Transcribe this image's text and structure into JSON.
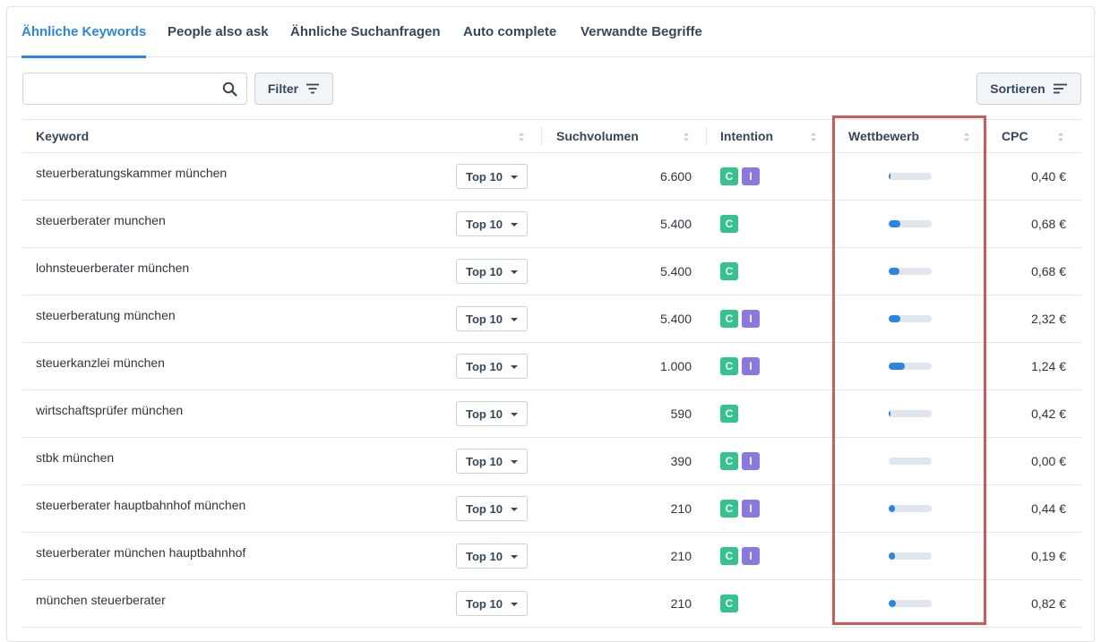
{
  "tabs": [
    {
      "label": "Ähnliche Keywords",
      "active": true
    },
    {
      "label": "People also ask",
      "active": false
    },
    {
      "label": "Ähnliche Suchanfragen",
      "active": false
    },
    {
      "label": "Auto complete",
      "active": false
    },
    {
      "label": "Verwandte Begriffe",
      "active": false
    }
  ],
  "toolbar": {
    "search_value": "",
    "search_placeholder": "",
    "filter_label": "Filter",
    "sort_label": "Sortieren"
  },
  "table": {
    "columns": {
      "keyword": "Keyword",
      "volume": "Suchvolumen",
      "intent": "Intention",
      "competition": "Wettbewerb",
      "cpc": "CPC"
    },
    "rows": [
      {
        "keyword": "steuerberatungskammer münchen",
        "serp": "Top 10",
        "volume": "6.600",
        "intents": [
          "C",
          "I"
        ],
        "competition": 0.02,
        "cpc": "0,40 €"
      },
      {
        "keyword": "steuerberater munchen",
        "serp": "Top 10",
        "volume": "5.400",
        "intents": [
          "C"
        ],
        "competition": 0.27,
        "cpc": "0,68 €"
      },
      {
        "keyword": "lohnsteuerberater münchen",
        "serp": "Top 10",
        "volume": "5.400",
        "intents": [
          "C"
        ],
        "competition": 0.25,
        "cpc": "0,68 €"
      },
      {
        "keyword": "steuerberatung münchen",
        "serp": "Top 10",
        "volume": "5.400",
        "intents": [
          "C",
          "I"
        ],
        "competition": 0.27,
        "cpc": "2,32 €"
      },
      {
        "keyword": "steuerkanzlei münchen",
        "serp": "Top 10",
        "volume": "1.000",
        "intents": [
          "C",
          "I"
        ],
        "competition": 0.38,
        "cpc": "1,24 €"
      },
      {
        "keyword": "wirtschaftsprüfer münchen",
        "serp": "Top 10",
        "volume": "590",
        "intents": [
          "C"
        ],
        "competition": 0.02,
        "cpc": "0,42 €"
      },
      {
        "keyword": "stbk münchen",
        "serp": "Top 10",
        "volume": "390",
        "intents": [
          "C",
          "I"
        ],
        "competition": 0.0,
        "cpc": "0,00 €"
      },
      {
        "keyword": "steuerberater hauptbahnhof münchen",
        "serp": "Top 10",
        "volume": "210",
        "intents": [
          "C",
          "I"
        ],
        "competition": 0.15,
        "cpc": "0,44 €"
      },
      {
        "keyword": "steuerberater münchen hauptbahnhof",
        "serp": "Top 10",
        "volume": "210",
        "intents": [
          "C",
          "I"
        ],
        "competition": 0.15,
        "cpc": "0,19 €"
      },
      {
        "keyword": "münchen steuerberater",
        "serp": "Top 10",
        "volume": "210",
        "intents": [
          "C"
        ],
        "competition": 0.17,
        "cpc": "0,82 €"
      }
    ]
  },
  "colors": {
    "accent": "#2a86e6",
    "intent_c": "#34c38f",
    "intent_i": "#8a77e0",
    "highlight": "#cf5a57"
  }
}
